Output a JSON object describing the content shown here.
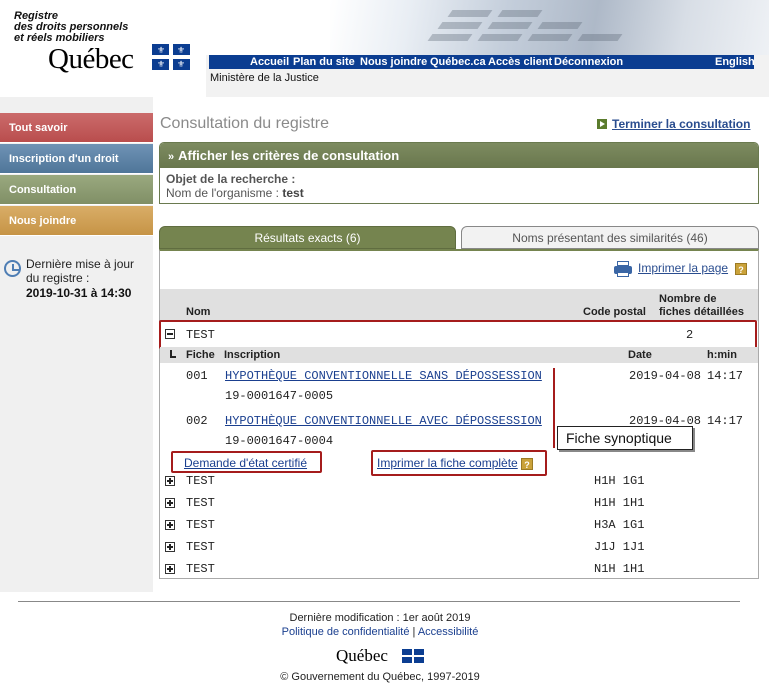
{
  "header": {
    "brand_line1": "Registre",
    "brand_line2": "des droits personnels",
    "brand_line3": "et réels mobiliers",
    "logo_text": "Québec",
    "ministere": "Ministère de la Justice",
    "nav": [
      "Accueil",
      "Plan du site",
      "Nous joindre",
      "Québec.ca",
      "Accès client",
      "Déconnexion"
    ],
    "language": "English"
  },
  "sidebar": {
    "items": [
      "Tout savoir",
      "Inscription d'un droit",
      "Consultation",
      "Nous joindre"
    ],
    "maj_label": "Dernière mise à jour du registre :",
    "maj_date": "2019-10-31 à 14:30"
  },
  "main": {
    "title": "Consultation du registre",
    "end_link": "Terminer la consultation",
    "criteria": {
      "header": "Afficher les critères de consultation",
      "objet_label": "Objet de la recherche :",
      "org_label": "Nom de l'organisme :",
      "org_value": "test"
    },
    "tabs": [
      "Résultats exacts (6)",
      "Noms présentant des similarités (46)"
    ],
    "print_page": "Imprimer la page",
    "help_glyph": "?",
    "columns": {
      "nom": "Nom",
      "code_postal": "Code postal",
      "nombre_line1": "Nombre de",
      "nombre_line2": "fiches détaillées"
    },
    "expanded": {
      "name": "TEST",
      "count": "2",
      "subcolumns": [
        "Fiche",
        "Inscription",
        "Date",
        "h:min"
      ],
      "fiches": [
        {
          "num": "001",
          "inscription": "HYPOTHÈQUE CONVENTIONNELLE SANS DÉPOSSESSION",
          "ref": "19-0001647-0005",
          "date": "2019-04-08",
          "time": "14:17"
        },
        {
          "num": "002",
          "inscription": "HYPOTHÈQUE CONVENTIONNELLE AVEC DÉPOSSESSION",
          "ref": "19-0001647-0004",
          "date": "2019-04-08",
          "time": "14:17"
        }
      ],
      "demande_link": "Demande d'état certifié",
      "imprimer_link": "Imprimer la fiche complète"
    },
    "rows": [
      {
        "name": "TEST",
        "code": "H1H 1G1"
      },
      {
        "name": "TEST",
        "code": "H1H 1H1"
      },
      {
        "name": "TEST",
        "code": "H3A 1G1"
      },
      {
        "name": "TEST",
        "code": "J1J 1J1"
      },
      {
        "name": "TEST",
        "code": "N1H 1H1"
      }
    ],
    "callout": "Fiche synoptique"
  },
  "footer": {
    "modified": "Dernière modification : 1er août 2019",
    "privacy": "Politique de confidentialité",
    "separator": "|",
    "accessibility": "Accessibilité",
    "logo_text": "Québec",
    "copyright": "© Gouvernement du Québec, 1997-2019"
  },
  "colors": {
    "nav_blue": "#0b3d91",
    "tab_green": "#75844f",
    "annotation_red": "#a51c1c"
  }
}
